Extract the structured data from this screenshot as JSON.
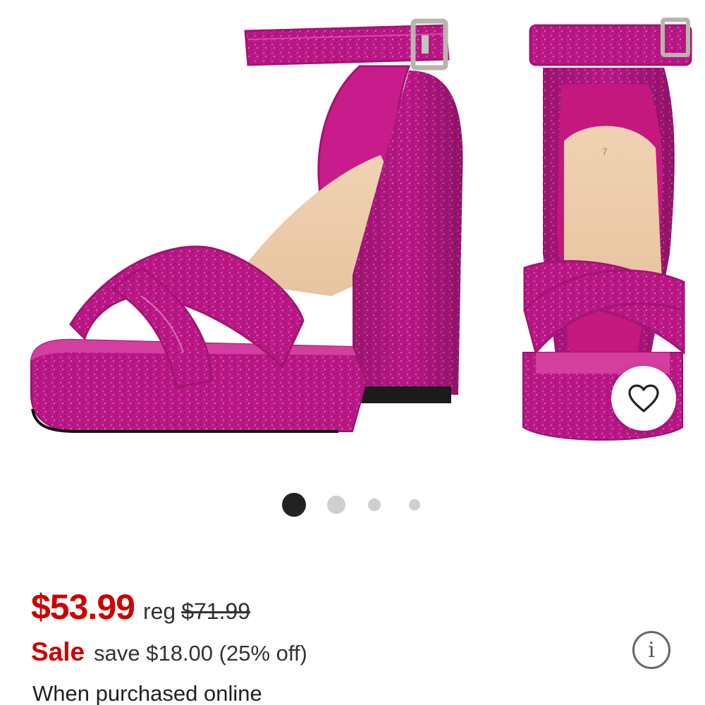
{
  "product": {
    "image_alt": "Pink glitter platform block heel sandals with ankle strap",
    "image_insole_size": "7",
    "carousel_total": 4,
    "carousel_active_index": 0
  },
  "actions": {
    "favorite_icon": "heart-icon",
    "info_icon": "info-circle-icon",
    "info_glyph": "i"
  },
  "pricing": {
    "current_price": "$53.99",
    "reg_label": "reg",
    "reg_price": "$71.99",
    "sale_label": "Sale",
    "save_text": "save $18.00 (25% off)",
    "note": "When purchased online"
  },
  "colors": {
    "sale_red": "#cc0000",
    "shoe_pink": "#c01c8a",
    "active_dot": "#222222",
    "inactive_dot": "#cfcfcf"
  }
}
